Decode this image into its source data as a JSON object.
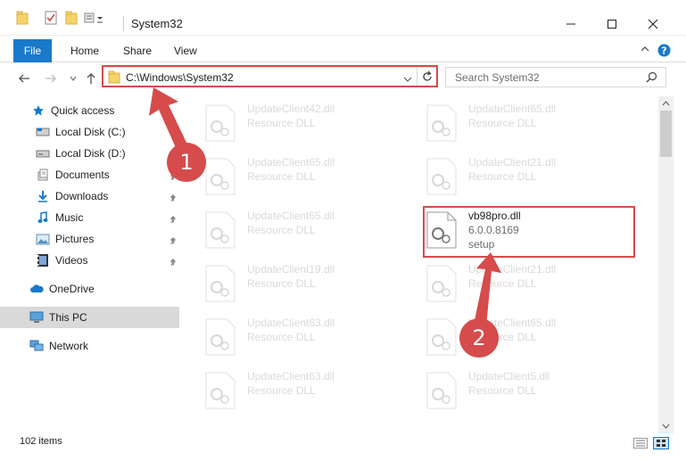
{
  "window": {
    "title": "System32",
    "controls": [
      "minimize",
      "maximize",
      "close"
    ]
  },
  "ribbon": {
    "tabs": [
      "File",
      "Home",
      "Share",
      "View"
    ],
    "help_icon": "help-icon",
    "expand_icon": "chevron-down-icon"
  },
  "address": {
    "path": "C:\\Windows\\System32",
    "search_placeholder": "Search System32"
  },
  "sidebar": {
    "items": [
      {
        "label": "Quick access",
        "icon": "star-icon"
      },
      {
        "label": "Local Disk (C:)",
        "icon": "drive-icon"
      },
      {
        "label": "Local Disk (D:)",
        "icon": "drive-icon"
      },
      {
        "label": "Documents",
        "icon": "documents-icon"
      },
      {
        "label": "Downloads",
        "icon": "download-icon"
      },
      {
        "label": "Music",
        "icon": "music-icon"
      },
      {
        "label": "Pictures",
        "icon": "pictures-icon"
      },
      {
        "label": "Videos",
        "icon": "videos-icon"
      },
      {
        "label": "OneDrive",
        "icon": "cloud-icon"
      },
      {
        "label": "This PC",
        "icon": "computer-icon"
      },
      {
        "label": "Network",
        "icon": "network-icon"
      }
    ]
  },
  "files": [
    {
      "name": "UpdateClient42.dll",
      "sub": "Resource DLL"
    },
    {
      "name": "UpdateClient65.dll",
      "sub": "Resource DLL"
    },
    {
      "name": "UpdateClient65.dll",
      "sub": "Resource DLL"
    },
    {
      "name": "UpdateClient21.dll",
      "sub": "Resource DLL"
    },
    {
      "name": "UpdateClient65.dll",
      "sub": "Resource DLL"
    },
    {
      "name": "vb98pro.dll",
      "sub": "6.0.0.8169",
      "sub2": "setup"
    },
    {
      "name": "UpdateClient19.dll",
      "sub": "Resource DLL"
    },
    {
      "name": "UpdateClient21.dll",
      "sub": "Resource DLL"
    },
    {
      "name": "UpdateClient63.dll",
      "sub": "Resource DLL"
    },
    {
      "name": "UpdateClient65.dll",
      "sub": "Resource DLL"
    },
    {
      "name": "UpdateClient63.dll",
      "sub": "Resource DLL"
    },
    {
      "name": "UpdateClient5.dll",
      "sub": "Resource DLL"
    }
  ],
  "status": {
    "items_count": "102 items"
  },
  "annotations": {
    "step1": "1",
    "step2": "2",
    "color": "#d64b4b"
  }
}
